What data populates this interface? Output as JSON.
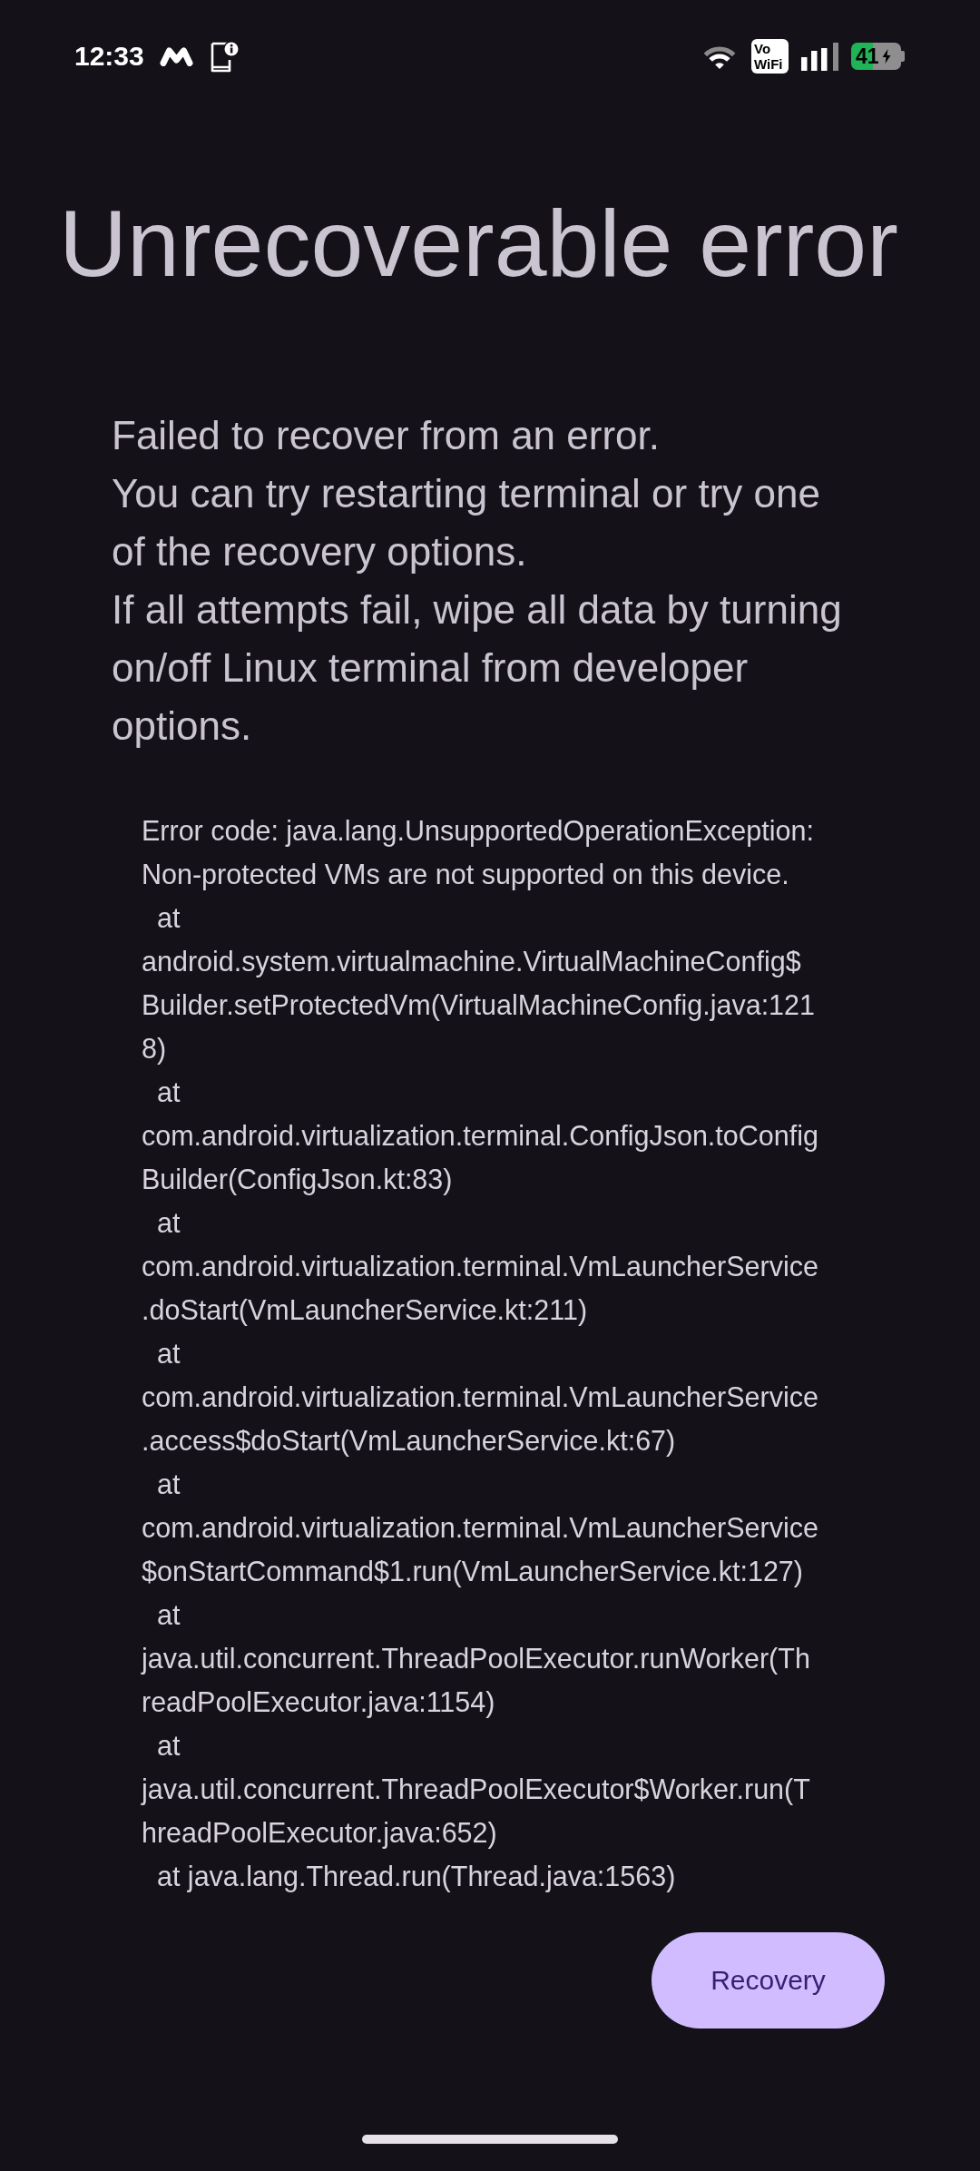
{
  "status_bar": {
    "time": "12:33",
    "vowifi_label": "Vo WiFi",
    "battery_text": "41"
  },
  "title": "Unrecoverable error",
  "message": "Failed to recover from an error.\nYou can try restarting terminal or try one of the recovery options.\nIf all attempts fail, wipe all data by turning on/off Linux terminal from developer options.",
  "error_details": "Error code: java.lang.UnsupportedOperationException: Non-protected VMs are not supported on this device.\n  at android.system.virtualmachine.VirtualMachineConfig$Builder.setProtectedVm(VirtualMachineConfig.java:1218)\n  at com.android.virtualization.terminal.ConfigJson.toConfigBuilder(ConfigJson.kt:83)\n  at com.android.virtualization.terminal.VmLauncherService.doStart(VmLauncherService.kt:211)\n  at com.android.virtualization.terminal.VmLauncherService.access$doStart(VmLauncherService.kt:67)\n  at com.android.virtualization.terminal.VmLauncherService$onStartCommand$1.run(VmLauncherService.kt:127)\n  at java.util.concurrent.ThreadPoolExecutor.runWorker(ThreadPoolExecutor.java:1154)\n  at java.util.concurrent.ThreadPoolExecutor$Worker.run(ThreadPoolExecutor.java:652)\n  at java.lang.Thread.run(Thread.java:1563)",
  "buttons": [
    "Recovery"
  ]
}
